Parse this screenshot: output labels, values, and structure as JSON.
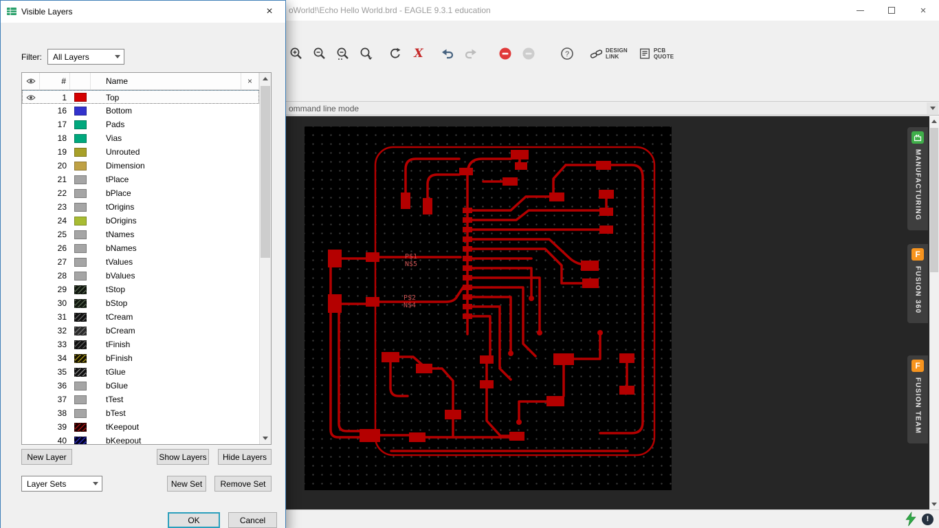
{
  "window": {
    "title": "oWorld!\\Echo Hello World.brd - EAGLE 9.3.1 education",
    "close_glyph": "×"
  },
  "toolbar": {
    "help_glyph": "?",
    "script_x_glyph": "X",
    "design_link_line1": "DESIGN",
    "design_link_line2": "LINK",
    "pcb_quote_line1": "PCB",
    "pcb_quote_line2": "QUOTE"
  },
  "command_line": {
    "text": "ommand line mode"
  },
  "dialog": {
    "title": "Visible Layers",
    "filter_label": "Filter:",
    "filter_value": "All Layers",
    "header": {
      "number": "#",
      "name": "Name",
      "clear": "×"
    },
    "layers": [
      {
        "num": "1",
        "name": "Top",
        "color": "#d40000",
        "eye": true,
        "selected": true
      },
      {
        "num": "16",
        "name": "Bottom",
        "color": "#3232cd"
      },
      {
        "num": "17",
        "name": "Pads",
        "color": "#00a87d"
      },
      {
        "num": "18",
        "name": "Vias",
        "color": "#00a87d"
      },
      {
        "num": "19",
        "name": "Unrouted",
        "color": "#a8a028"
      },
      {
        "num": "20",
        "name": "Dimension",
        "color": "#bfa145"
      },
      {
        "num": "21",
        "name": "tPlace",
        "color": "#a5a5a5"
      },
      {
        "num": "22",
        "name": "bPlace",
        "color": "#a5a5a5"
      },
      {
        "num": "23",
        "name": "tOrigins",
        "color": "#a5a5a5"
      },
      {
        "num": "24",
        "name": "bOrigins",
        "color": "#a8bc32"
      },
      {
        "num": "25",
        "name": "tNames",
        "color": "#a5a5a5"
      },
      {
        "num": "26",
        "name": "bNames",
        "color": "#a5a5a5"
      },
      {
        "num": "27",
        "name": "tValues",
        "color": "#a5a5a5"
      },
      {
        "num": "28",
        "name": "bValues",
        "color": "#a5a5a5"
      },
      {
        "num": "29",
        "name": "tStop",
        "color": "#11170f",
        "hatch": "#4f5f4a"
      },
      {
        "num": "30",
        "name": "bStop",
        "color": "#11170f",
        "hatch": "#4f5f4a"
      },
      {
        "num": "31",
        "name": "tCream",
        "color": "#101010",
        "hatch": "#5c5c5c"
      },
      {
        "num": "32",
        "name": "bCream",
        "color": "#2a2a2a",
        "hatch": "#6e6e6e"
      },
      {
        "num": "33",
        "name": "tFinish",
        "color": "#101010",
        "hatch": "#565656"
      },
      {
        "num": "34",
        "name": "bFinish",
        "color": "#171200",
        "hatch": "#9d8d16"
      },
      {
        "num": "35",
        "name": "tGlue",
        "color": "#101010",
        "hatch": "#7d7d7d"
      },
      {
        "num": "36",
        "name": "bGlue",
        "color": "#a5a5a5"
      },
      {
        "num": "37",
        "name": "tTest",
        "color": "#a5a5a5"
      },
      {
        "num": "38",
        "name": "bTest",
        "color": "#a5a5a5"
      },
      {
        "num": "39",
        "name": "tKeepout",
        "color": "#1c0000",
        "hatch": "#a31212"
      },
      {
        "num": "40",
        "name": "bKeepout",
        "color": "#000022",
        "hatch": "#2a2ab4"
      }
    ],
    "layer_sets_value": "Layer Sets",
    "buttons": {
      "new_layer": "New Layer",
      "show_layers": "Show Layers",
      "hide_layers": "Hide Layers",
      "new_set": "New Set",
      "remove_set": "Remove Set",
      "ok": "OK",
      "cancel": "Cancel"
    }
  },
  "canvas": {
    "trace_color": "#b40000",
    "labels": [
      {
        "line1": "P$1",
        "line2": "N$5"
      },
      {
        "line1": "P$2",
        "line2": "N$4"
      }
    ]
  },
  "side_tabs": [
    {
      "label": "MANUFACTURING",
      "icon_color": "#3fae49"
    },
    {
      "label": "FUSION 360",
      "icon_letter": "F",
      "icon_color": "#f7941e"
    },
    {
      "label": "FUSION TEAM",
      "icon_letter": "F",
      "icon_color": "#f7941e"
    }
  ],
  "status": {
    "alert_glyph": "!"
  }
}
